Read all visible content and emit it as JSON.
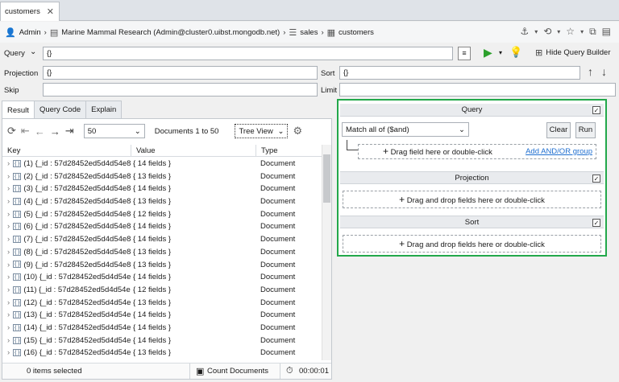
{
  "tab": {
    "title": "customers",
    "close": "✕"
  },
  "breadcrumb": {
    "user": "Admin",
    "connection": "Marine Mammal Research (Admin@cluster0.uibst.mongodb.net)",
    "database": "sales",
    "collection": "customers"
  },
  "query_bar": {
    "query_label": "Query",
    "query_value": "{}",
    "projection_label": "Projection",
    "projection_value": "{}",
    "sort_label": "Sort",
    "sort_value": "{}",
    "skip_label": "Skip",
    "skip_value": "",
    "limit_label": "Limit",
    "limit_value": "",
    "hide_qb_label": "Hide Query Builder"
  },
  "result_tabs": [
    {
      "label": "Result"
    },
    {
      "label": "Query Code"
    },
    {
      "label": "Explain"
    }
  ],
  "result_toolbar": {
    "page_size": "50",
    "documents_range": "Documents 1 to 50",
    "view_mode": "Tree View"
  },
  "columns": {
    "key": "Key",
    "value": "Value",
    "type": "Type"
  },
  "rows": [
    {
      "key": "(1) {_id : 57d28452ed5d4d54e8",
      "value": "{ 14 fields }",
      "type": "Document"
    },
    {
      "key": "(2) {_id : 57d28452ed5d4d54e8",
      "value": "{ 13 fields }",
      "type": "Document"
    },
    {
      "key": "(3) {_id : 57d28452ed5d4d54e8",
      "value": "{ 14 fields }",
      "type": "Document"
    },
    {
      "key": "(4) {_id : 57d28452ed5d4d54e8",
      "value": "{ 13 fields }",
      "type": "Document"
    },
    {
      "key": "(5) {_id : 57d28452ed5d4d54e8",
      "value": "{ 12 fields }",
      "type": "Document"
    },
    {
      "key": "(6) {_id : 57d28452ed5d4d54e8",
      "value": "{ 14 fields }",
      "type": "Document"
    },
    {
      "key": "(7) {_id : 57d28452ed5d4d54e8",
      "value": "{ 14 fields }",
      "type": "Document"
    },
    {
      "key": "(8) {_id : 57d28452ed5d4d54e8",
      "value": "{ 13 fields }",
      "type": "Document"
    },
    {
      "key": "(9) {_id : 57d28452ed5d4d54e8",
      "value": "{ 13 fields }",
      "type": "Document"
    },
    {
      "key": "(10) {_id : 57d28452ed5d4d54e",
      "value": "{ 14 fields }",
      "type": "Document"
    },
    {
      "key": "(11) {_id : 57d28452ed5d4d54e",
      "value": "{ 12 fields }",
      "type": "Document"
    },
    {
      "key": "(12) {_id : 57d28452ed5d4d54e",
      "value": "{ 13 fields }",
      "type": "Document"
    },
    {
      "key": "(13) {_id : 57d28452ed5d4d54e",
      "value": "{ 14 fields }",
      "type": "Document"
    },
    {
      "key": "(14) {_id : 57d28452ed5d4d54e",
      "value": "{ 14 fields }",
      "type": "Document"
    },
    {
      "key": "(15) {_id : 57d28452ed5d4d54e",
      "value": "{ 14 fields }",
      "type": "Document"
    },
    {
      "key": "(16) {_id : 57d28452ed5d4d54e",
      "value": "{ 13 fields }",
      "type": "Document"
    }
  ],
  "status": {
    "selected": "0 items selected",
    "count_documents": "Count Documents",
    "timer": "00:00:01"
  },
  "query_builder": {
    "query_title": "Query",
    "match_select": "Match all of ($and)",
    "clear_label": "Clear",
    "run_label": "Run",
    "query_drop_hint": "Drag field here or double-click",
    "add_group_link": "Add AND/OR group",
    "projection_title": "Projection",
    "projection_drop_hint": "Drag and drop fields here or double-click",
    "sort_title": "Sort",
    "sort_drop_hint": "Drag and drop fields here or double-click"
  },
  "colors": {
    "accent_green": "#22a84a",
    "link_blue": "#1f6fd0"
  }
}
